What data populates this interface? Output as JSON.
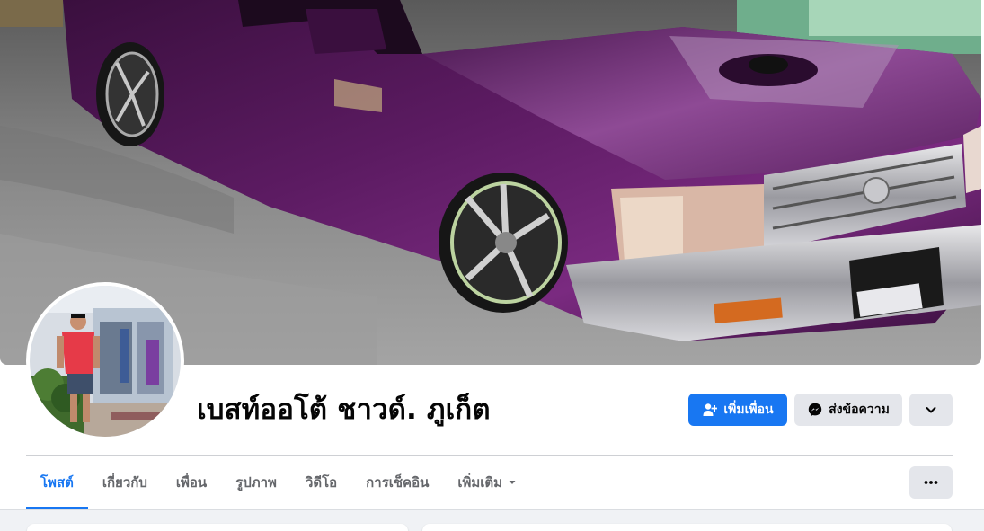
{
  "profile": {
    "name": "เบสท์ออโต้ ชาวด์. ภูเก็ต"
  },
  "actions": {
    "add_friend_label": "เพิ่มเพื่อน",
    "message_label": "ส่งข้อความ"
  },
  "tabs": [
    {
      "label": "โพสต์",
      "active": true
    },
    {
      "label": "เกี่ยวกับ",
      "active": false
    },
    {
      "label": "เพื่อน",
      "active": false
    },
    {
      "label": "รูปภาพ",
      "active": false
    },
    {
      "label": "วิดีโอ",
      "active": false
    },
    {
      "label": "การเช็คอิน",
      "active": false
    },
    {
      "label": "เพิ่มเติม",
      "active": false
    }
  ],
  "icons": {
    "add_friend": "person-plus-icon",
    "message": "messenger-icon",
    "dropdown": "chevron-down-icon",
    "tabs_more": "ellipsis-icon",
    "more_caret": "caret-down-icon"
  },
  "colors": {
    "primary": "#1877f2",
    "secondary_button": "#e4e6eb",
    "tab_inactive": "#65676b",
    "feed_background": "#f0f2f5"
  }
}
